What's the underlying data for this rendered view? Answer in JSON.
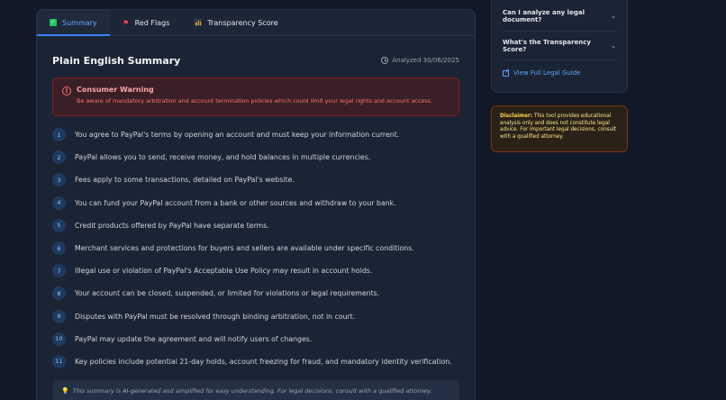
{
  "tabs": [
    {
      "label": "Summary",
      "icon": "check-square-icon"
    },
    {
      "label": "Red Flags",
      "icon": "flag-icon"
    },
    {
      "label": "Transparency Score",
      "icon": "bar-chart-icon"
    }
  ],
  "summary": {
    "title": "Plain English Summary",
    "analyzed": "Analyzed 30/06/2025"
  },
  "warning": {
    "title": "Consumer Warning",
    "text": "Be aware of mandatory arbitration and account termination policies which could limit your legal rights and account access."
  },
  "points": [
    {
      "num": "1",
      "text": "You agree to PayPal's terms by opening an account and must keep your information current."
    },
    {
      "num": "2",
      "text": "PayPal allows you to send, receive money, and hold balances in multiple currencies."
    },
    {
      "num": "3",
      "text": "Fees apply to some transactions, detailed on PayPal's website."
    },
    {
      "num": "4",
      "text": "You can fund your PayPal account from a bank or other sources and withdraw to your bank."
    },
    {
      "num": "5",
      "text": "Credit products offered by PayPal have separate terms."
    },
    {
      "num": "6",
      "text": "Merchant services and protections for buyers and sellers are available under specific conditions."
    },
    {
      "num": "7",
      "text": "Illegal use or violation of PayPal's Acceptable Use Policy may result in account holds."
    },
    {
      "num": "8",
      "text": "Your account can be closed, suspended, or limited for violations or legal requirements."
    },
    {
      "num": "9",
      "text": "Disputes with PayPal must be resolved through binding arbitration, not in court."
    },
    {
      "num": "10",
      "text": "PayPal may update the agreement and will notify users of changes."
    },
    {
      "num": "11",
      "text": "Key policies include potential 21-day holds, account freezing for fraud, and mandatory identity verification."
    }
  ],
  "ai_note": "This summary is AI-generated and simplified for easy understanding. For legal decisions, consult with a qualified attorney.",
  "faq": {
    "items": [
      {
        "question": "Can I analyze any legal document?"
      },
      {
        "question": "What's the Transparency Score?"
      }
    ],
    "link_label": "View Full Legal Guide"
  },
  "disclaimer": {
    "label": "Disclaimer:",
    "text": " This tool provides educational analysis only and does not constitute legal advice. For important legal decisions, consult with a qualified attorney."
  }
}
